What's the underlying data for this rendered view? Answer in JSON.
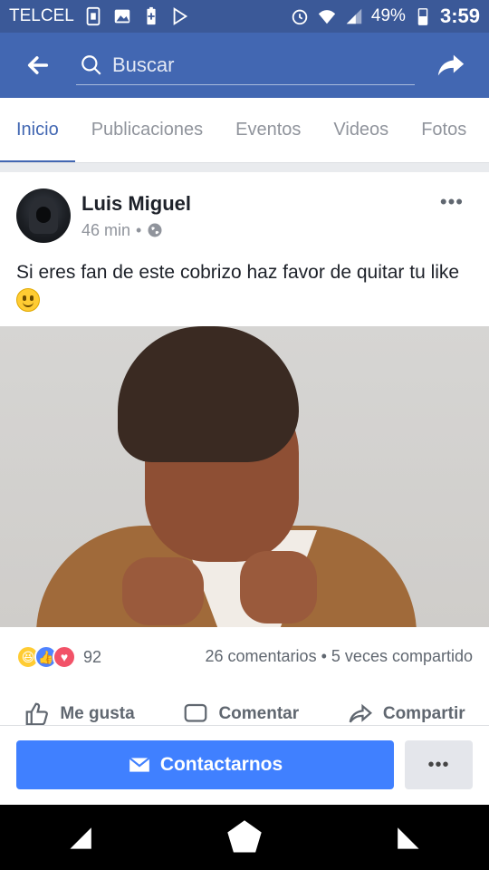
{
  "status_bar": {
    "carrier": "TELCEL",
    "battery": "49%",
    "time": "3:59",
    "icons": [
      "sim-icon",
      "image-icon",
      "battery-saver-icon",
      "play-store-icon",
      "alarm-icon",
      "wifi-icon",
      "signal-icon",
      "battery-icon"
    ]
  },
  "app_bar": {
    "search_placeholder": "Buscar"
  },
  "tabs": [
    {
      "label": "Inicio",
      "active": true
    },
    {
      "label": "Publicaciones",
      "active": false
    },
    {
      "label": "Eventos",
      "active": false
    },
    {
      "label": "Videos",
      "active": false
    },
    {
      "label": "Fotos",
      "active": false
    }
  ],
  "post": {
    "author": "Luis Miguel",
    "time": "46 min",
    "privacy": "•",
    "text": "Si eres fan de este cobrizo haz favor de quitar tu like",
    "reactions_count": "92",
    "comments": "26 comentarios",
    "separator": "•",
    "shares": "5 veces compartido"
  },
  "actions": {
    "like": "Me gusta",
    "comment": "Comentar",
    "share": "Compartir"
  },
  "cta": {
    "contact": "Contactarnos",
    "more": "•••"
  },
  "colors": {
    "brand": "#4267b2",
    "status_bar": "#3b5998",
    "cta": "#4080ff"
  }
}
